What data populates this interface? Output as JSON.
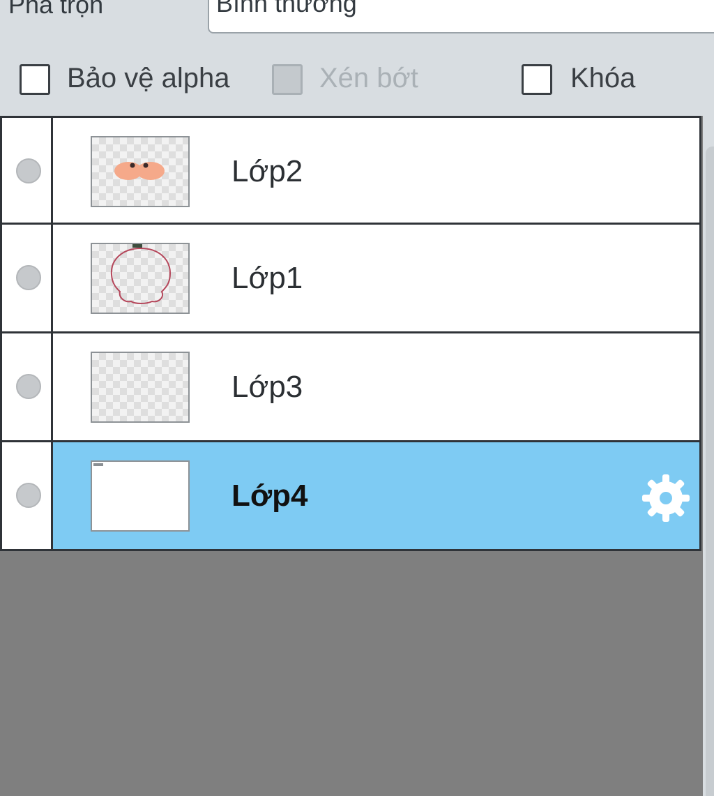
{
  "blend": {
    "label": "Pha trộn",
    "value": "Bình thường"
  },
  "options": {
    "protect_alpha": {
      "label": "Bảo vệ alpha",
      "checked": false,
      "enabled": true
    },
    "clip": {
      "label": "Xén bớt",
      "checked": false,
      "enabled": false
    },
    "lock": {
      "label": "Khóa",
      "checked": false,
      "enabled": true
    }
  },
  "layers": [
    {
      "name": "Lớp2",
      "selected": false,
      "thumbnail": "orange-shapes"
    },
    {
      "name": "Lớp1",
      "selected": false,
      "thumbnail": "outline-sketch"
    },
    {
      "name": "Lớp3",
      "selected": false,
      "thumbnail": "transparent"
    },
    {
      "name": "Lớp4",
      "selected": true,
      "thumbnail": "white"
    }
  ],
  "icons": {
    "visibility": "visibility-dot-icon",
    "settings": "gear-icon"
  },
  "colors": {
    "selected_row": "#7ecbf3",
    "empty_area": "#7f7f7f",
    "panel_bg": "#d8dde1"
  }
}
